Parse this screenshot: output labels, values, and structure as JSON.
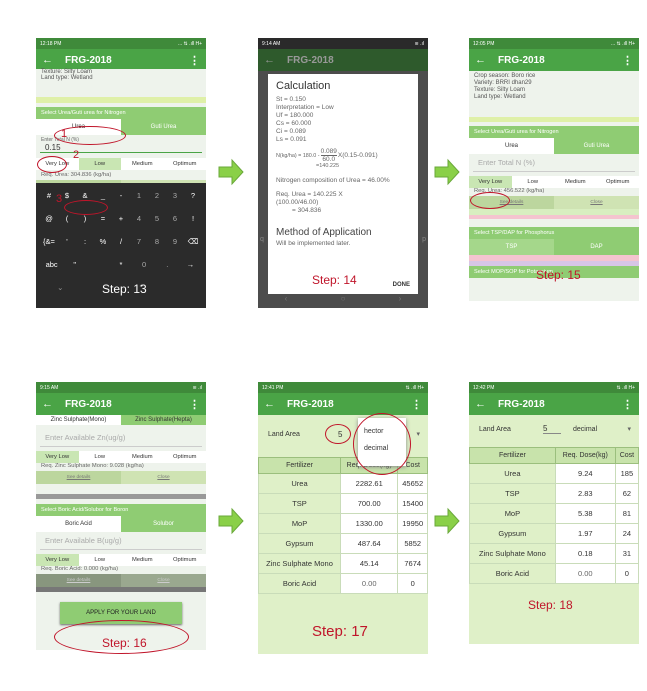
{
  "brand_color": "#4aa446",
  "accent_red": "#c0152a",
  "app_title": "FRG-2018",
  "p1": {
    "time": "12:18 PM",
    "sig": "... ⇅ .ıll H+",
    "texture": "Texture: Silty Loam",
    "land_type": "Land type: Wetland",
    "select_urea": "Select Urea/Guti urea for Nitrogen",
    "tab_urea": "Urea",
    "tab_guti": "Guti Urea",
    "enter_n": "Enter Total N (%)",
    "input_value": "0.15",
    "levels": [
      "Very Low",
      "Low",
      "Medium",
      "Optimum"
    ],
    "req": "Req. Urea: 304.836 (kg/ha)",
    "see_details": "See details",
    "close": "Close",
    "ann1": "1",
    "ann2": "2",
    "ann3": "3",
    "step": "Step: 13",
    "kb_rows": [
      [
        "#",
        "$",
        "&",
        "_",
        "-",
        "1",
        "2",
        "3",
        "?"
      ],
      [
        "@",
        "(",
        ")",
        "=",
        "+",
        "4",
        "5",
        "6",
        "!"
      ],
      [
        "{&=",
        "'",
        ":",
        "%",
        "/",
        "7",
        "8",
        "9",
        "⌫"
      ],
      [
        "abc",
        "\"",
        "",
        "*",
        "0",
        ".",
        "→"
      ]
    ],
    "kb_nav": [
      "⌄",
      "",
      "⌃",
      ""
    ]
  },
  "p2": {
    "time": "9:14 AM",
    "sig": "≋ .ıl",
    "title": "Calculation",
    "lines": [
      "St = 0.150",
      "Interpretation = Low",
      "Uf = 180.000",
      "Cs = 60.000",
      "Ci = 0.089",
      "Ls = 0.091"
    ],
    "formula_left": "N(kg/ha) = 180.0 -",
    "formula_num": "0.089",
    "formula_den": "60.0",
    "formula_right": "X(0.15-0.091)",
    "formula_res": "=140.225",
    "composition": "Nitrogen composition of Urea = 46.00%",
    "req1": "Req. Urea = 140.225 X",
    "req2": "(100.00/46.00)",
    "req3": "= 304.836",
    "method": "Method of Application",
    "later": "Will be implemented later.",
    "done": "DONE",
    "step": "Step: 14",
    "bg_letters": [
      "q",
      "p"
    ]
  },
  "p3": {
    "time": "12:05 PM",
    "sig": "... ⇅ .ıll H+",
    "info": [
      "Crop season: Boro rice",
      "Variety: BRRI dhan29",
      "Texture: Silty Loam",
      "Land type: Wetland"
    ],
    "select_urea": "Select Urea/Guti urea for Nitrogen",
    "tab_urea": "Urea",
    "tab_guti": "Guti Urea",
    "hint": "Enter Total N (%)",
    "levels": [
      "Very Low",
      "Low",
      "Medium",
      "Optimum"
    ],
    "req": "Req. Urea: 456.522 (kg/ha)",
    "see_details": "See details",
    "close": "Close",
    "select_tsp": "Select TSP/DAP for Phosphorus",
    "tab_tsp": "TSP",
    "tab_dap": "DAP",
    "select_mop": "Select MOP/SOP for Potassium",
    "step": "Step: 15"
  },
  "p4": {
    "time": "9:15 AM",
    "sig": "≋ .ıl",
    "tab_mono": "Zinc Sulphate(Mono)",
    "tab_hepta": "Zinc Sulphate(Hepta)",
    "hint_zn": "Enter Available Zn(ug/g)",
    "levels": [
      "Very Low",
      "Low",
      "Medium",
      "Optimum"
    ],
    "req_zn": "Req. Zinc Sulphate Mono: 9.028 (kg/ha)",
    "see_details": "See details",
    "close": "Close",
    "select_boron": "Select Boric Acid/Solubor for Boron",
    "tab_boric": "Boric Acid",
    "tab_solubor": "Solubor",
    "hint_b": "Enter Available B(ug/g)",
    "req_b": "Req. Boric Acid: 0.000 (kg/ha)",
    "apply": "APPLY FOR YOUR LAND",
    "step": "Step: 16"
  },
  "p5": {
    "time": "12:41 PM",
    "sig": "⇅ .ıll H+",
    "land_area": "Land Area",
    "land_value": "5",
    "options": [
      "hector",
      "decimal"
    ],
    "headers": [
      "Fertilizer",
      "Req. Dose(kg)",
      "Cost"
    ],
    "rows": [
      [
        "Urea",
        "2282.61",
        "45652"
      ],
      [
        "TSP",
        "700.00",
        "15400"
      ],
      [
        "MoP",
        "1330.00",
        "19950"
      ],
      [
        "Gypsum",
        "487.64",
        "5852"
      ],
      [
        "Zinc Sulphate Mono",
        "45.14",
        "7674"
      ],
      [
        "Boric Acid",
        "0.00",
        "0"
      ]
    ],
    "step": "Step: 17"
  },
  "p6": {
    "time": "12:42 PM",
    "sig": "⇅ .ıll H+",
    "land_area": "Land Area",
    "land_value": "5",
    "unit": "decimal",
    "headers": [
      "Fertilizer",
      "Req. Dose(kg)",
      "Cost"
    ],
    "rows": [
      [
        "Urea",
        "9.24",
        "185"
      ],
      [
        "TSP",
        "2.83",
        "62"
      ],
      [
        "MoP",
        "5.38",
        "81"
      ],
      [
        "Gypsum",
        "1.97",
        "24"
      ],
      [
        "Zinc Sulphate Mono",
        "0.18",
        "31"
      ],
      [
        "Boric Acid",
        "0.00",
        "0"
      ]
    ],
    "step": "Step: 18"
  }
}
